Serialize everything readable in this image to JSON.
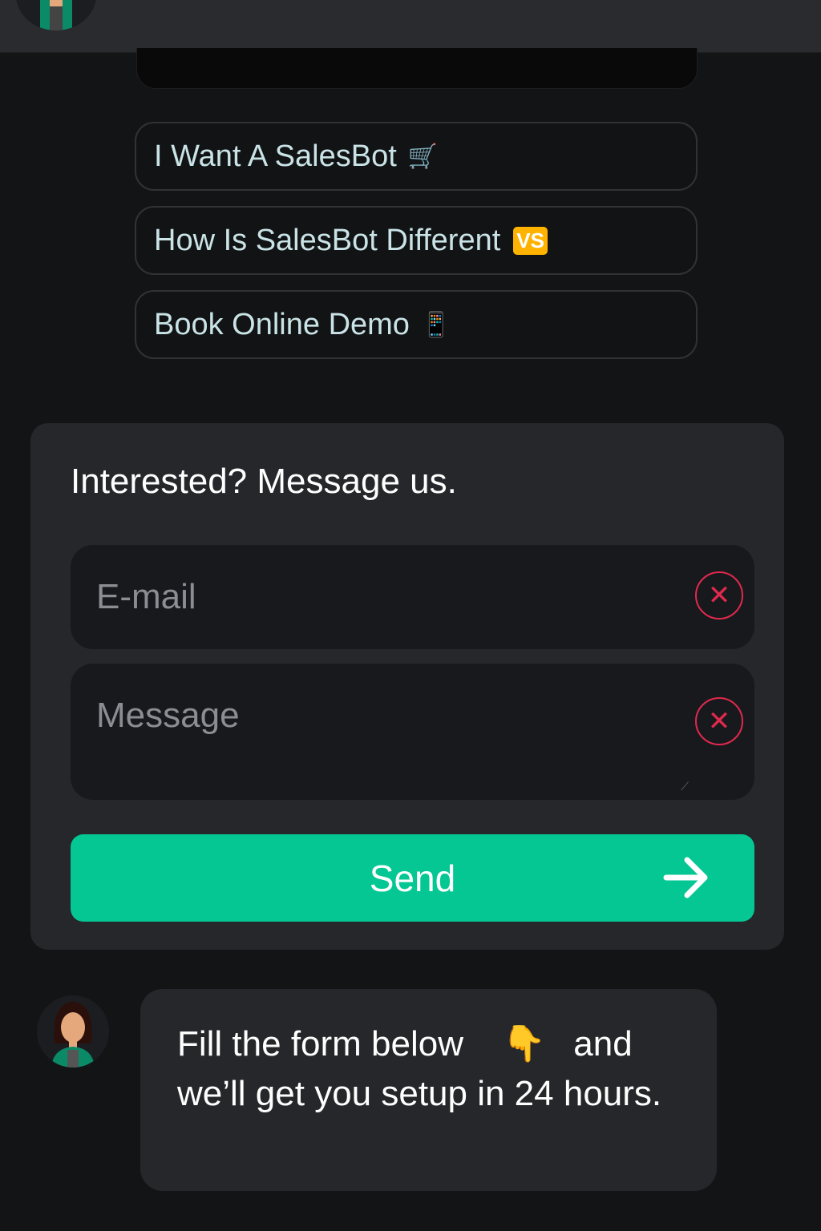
{
  "quick_replies": [
    {
      "label": "I Want A SalesBot",
      "icon": "🛒"
    },
    {
      "label": "How Is SalesBot Different",
      "icon": "VS"
    },
    {
      "label": "Book Online Demo",
      "icon": "📱"
    }
  ],
  "form": {
    "title": "Interested? Message us.",
    "email_placeholder": "E-mail",
    "message_placeholder": "Message",
    "send_label": "Send"
  },
  "bot_message": {
    "line1_before": "Fill the form below",
    "emoji": "👇",
    "line1_after": "and we’ll get you setup in 24 hours."
  },
  "colors": {
    "accent": "#05c793",
    "error": "#e0294e"
  }
}
